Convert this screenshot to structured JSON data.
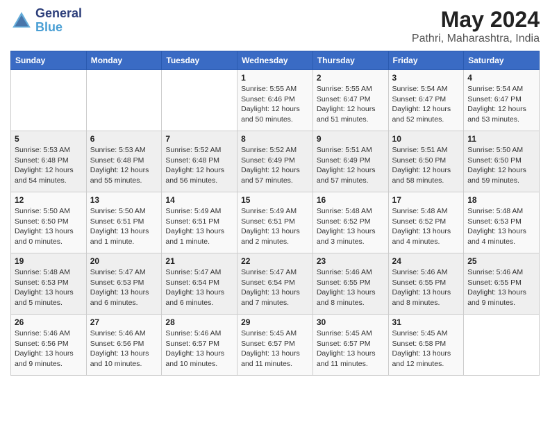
{
  "header": {
    "logo_line1": "General",
    "logo_line2": "Blue",
    "title": "May 2024",
    "subtitle": "Pathri, Maharashtra, India"
  },
  "weekdays": [
    "Sunday",
    "Monday",
    "Tuesday",
    "Wednesday",
    "Thursday",
    "Friday",
    "Saturday"
  ],
  "weeks": [
    [
      {
        "day": "",
        "info": ""
      },
      {
        "day": "",
        "info": ""
      },
      {
        "day": "",
        "info": ""
      },
      {
        "day": "1",
        "info": "Sunrise: 5:55 AM\nSunset: 6:46 PM\nDaylight: 12 hours\nand 50 minutes."
      },
      {
        "day": "2",
        "info": "Sunrise: 5:55 AM\nSunset: 6:47 PM\nDaylight: 12 hours\nand 51 minutes."
      },
      {
        "day": "3",
        "info": "Sunrise: 5:54 AM\nSunset: 6:47 PM\nDaylight: 12 hours\nand 52 minutes."
      },
      {
        "day": "4",
        "info": "Sunrise: 5:54 AM\nSunset: 6:47 PM\nDaylight: 12 hours\nand 53 minutes."
      }
    ],
    [
      {
        "day": "5",
        "info": "Sunrise: 5:53 AM\nSunset: 6:48 PM\nDaylight: 12 hours\nand 54 minutes."
      },
      {
        "day": "6",
        "info": "Sunrise: 5:53 AM\nSunset: 6:48 PM\nDaylight: 12 hours\nand 55 minutes."
      },
      {
        "day": "7",
        "info": "Sunrise: 5:52 AM\nSunset: 6:48 PM\nDaylight: 12 hours\nand 56 minutes."
      },
      {
        "day": "8",
        "info": "Sunrise: 5:52 AM\nSunset: 6:49 PM\nDaylight: 12 hours\nand 57 minutes."
      },
      {
        "day": "9",
        "info": "Sunrise: 5:51 AM\nSunset: 6:49 PM\nDaylight: 12 hours\nand 57 minutes."
      },
      {
        "day": "10",
        "info": "Sunrise: 5:51 AM\nSunset: 6:50 PM\nDaylight: 12 hours\nand 58 minutes."
      },
      {
        "day": "11",
        "info": "Sunrise: 5:50 AM\nSunset: 6:50 PM\nDaylight: 12 hours\nand 59 minutes."
      }
    ],
    [
      {
        "day": "12",
        "info": "Sunrise: 5:50 AM\nSunset: 6:50 PM\nDaylight: 13 hours\nand 0 minutes."
      },
      {
        "day": "13",
        "info": "Sunrise: 5:50 AM\nSunset: 6:51 PM\nDaylight: 13 hours\nand 1 minute."
      },
      {
        "day": "14",
        "info": "Sunrise: 5:49 AM\nSunset: 6:51 PM\nDaylight: 13 hours\nand 1 minute."
      },
      {
        "day": "15",
        "info": "Sunrise: 5:49 AM\nSunset: 6:51 PM\nDaylight: 13 hours\nand 2 minutes."
      },
      {
        "day": "16",
        "info": "Sunrise: 5:48 AM\nSunset: 6:52 PM\nDaylight: 13 hours\nand 3 minutes."
      },
      {
        "day": "17",
        "info": "Sunrise: 5:48 AM\nSunset: 6:52 PM\nDaylight: 13 hours\nand 4 minutes."
      },
      {
        "day": "18",
        "info": "Sunrise: 5:48 AM\nSunset: 6:53 PM\nDaylight: 13 hours\nand 4 minutes."
      }
    ],
    [
      {
        "day": "19",
        "info": "Sunrise: 5:48 AM\nSunset: 6:53 PM\nDaylight: 13 hours\nand 5 minutes."
      },
      {
        "day": "20",
        "info": "Sunrise: 5:47 AM\nSunset: 6:53 PM\nDaylight: 13 hours\nand 6 minutes."
      },
      {
        "day": "21",
        "info": "Sunrise: 5:47 AM\nSunset: 6:54 PM\nDaylight: 13 hours\nand 6 minutes."
      },
      {
        "day": "22",
        "info": "Sunrise: 5:47 AM\nSunset: 6:54 PM\nDaylight: 13 hours\nand 7 minutes."
      },
      {
        "day": "23",
        "info": "Sunrise: 5:46 AM\nSunset: 6:55 PM\nDaylight: 13 hours\nand 8 minutes."
      },
      {
        "day": "24",
        "info": "Sunrise: 5:46 AM\nSunset: 6:55 PM\nDaylight: 13 hours\nand 8 minutes."
      },
      {
        "day": "25",
        "info": "Sunrise: 5:46 AM\nSunset: 6:55 PM\nDaylight: 13 hours\nand 9 minutes."
      }
    ],
    [
      {
        "day": "26",
        "info": "Sunrise: 5:46 AM\nSunset: 6:56 PM\nDaylight: 13 hours\nand 9 minutes."
      },
      {
        "day": "27",
        "info": "Sunrise: 5:46 AM\nSunset: 6:56 PM\nDaylight: 13 hours\nand 10 minutes."
      },
      {
        "day": "28",
        "info": "Sunrise: 5:46 AM\nSunset: 6:57 PM\nDaylight: 13 hours\nand 10 minutes."
      },
      {
        "day": "29",
        "info": "Sunrise: 5:45 AM\nSunset: 6:57 PM\nDaylight: 13 hours\nand 11 minutes."
      },
      {
        "day": "30",
        "info": "Sunrise: 5:45 AM\nSunset: 6:57 PM\nDaylight: 13 hours\nand 11 minutes."
      },
      {
        "day": "31",
        "info": "Sunrise: 5:45 AM\nSunset: 6:58 PM\nDaylight: 13 hours\nand 12 minutes."
      },
      {
        "day": "",
        "info": ""
      }
    ]
  ]
}
